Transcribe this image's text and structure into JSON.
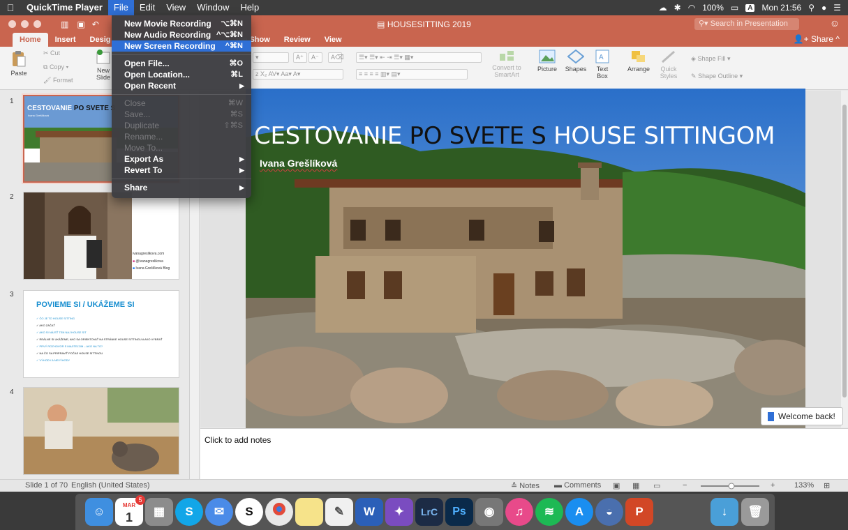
{
  "menubar": {
    "app": "QuickTime Player",
    "items": [
      "File",
      "Edit",
      "View",
      "Window",
      "Help"
    ],
    "battery": "100%",
    "clock": "Mon 21:56"
  },
  "window": {
    "title": "HOUSESITTING 2019",
    "search_placeholder": "Search in Presentation"
  },
  "ribbon": {
    "tabs": [
      "Home",
      "Insert",
      "Desig",
      "ide Show",
      "Review",
      "View"
    ],
    "share": "Share",
    "paste": "Paste",
    "cut": "Cut",
    "copy": "Copy",
    "format": "Format",
    "new_slide": "New\nSlide",
    "convert": "Convert to SmartArt",
    "picture": "Picture",
    "shapes": "Shapes",
    "text_box": "Text Box",
    "arrange": "Arrange",
    "quick_styles": "Quick Styles",
    "shape_fill": "Shape Fill",
    "shape_outline": "Shape Outline"
  },
  "file_menu": {
    "items": [
      {
        "label": "New Movie Recording",
        "shortcut": "⌥⌘N",
        "enabled": true,
        "highlight": false
      },
      {
        "label": "New Audio Recording",
        "shortcut": "^⌥⌘N",
        "enabled": true,
        "highlight": false
      },
      {
        "label": "New Screen Recording",
        "shortcut": "^⌘N",
        "enabled": true,
        "highlight": true
      },
      {
        "label": "Open File...",
        "shortcut": "⌘O",
        "enabled": true
      },
      {
        "label": "Open Location...",
        "shortcut": "⌘L",
        "enabled": true
      },
      {
        "label": "Open Recent",
        "shortcut": "",
        "enabled": true
      },
      {
        "label": "Close",
        "shortcut": "⌘W",
        "enabled": false
      },
      {
        "label": "Save...",
        "shortcut": "⌘S",
        "enabled": false
      },
      {
        "label": "Duplicate",
        "shortcut": "⇧⌘S",
        "enabled": false
      },
      {
        "label": "Rename...",
        "shortcut": "",
        "enabled": false
      },
      {
        "label": "Move To...",
        "shortcut": "",
        "enabled": false
      },
      {
        "label": "Export As",
        "shortcut": "",
        "enabled": true
      },
      {
        "label": "Revert To",
        "shortcut": "",
        "enabled": true
      },
      {
        "label": "Share",
        "shortcut": "",
        "enabled": true
      }
    ]
  },
  "slides": {
    "numbers": [
      "1",
      "2",
      "3",
      "4"
    ],
    "s1_title_a": "CESTOVANIE",
    "s1_title_b": " PO SVETE S",
    "s1_sub": "Ivana Grešlíková",
    "s2_web": "ivanagreslikova.com",
    "s2_ig": "@ivanagreslikova",
    "s2_fb": "Ivana Grešlíková Blog",
    "s3_title": "POVIEME SI / UKÁŽEME SI",
    "s3_items": [
      "ČO JE TO HOUSE SITTING",
      "AKO ZAČAŤ",
      "AKO SI NÁJSŤ TEN NAJ HOUSE SIT",
      "REÁLNE SI UKÁŽEME, AKO SA ORIENTOVAŤ NA STRÁNKE HOUSE SITTINGU A AKO VYBRAŤ",
      "PRVÝ ROZHOVOR S MAJITEĽOM – AKO NA TO?",
      "NA ČO SA PRIPRAVIŤ POČAS HOUSE SITTINGU",
      "VÝHODY A NEVÝHODY"
    ]
  },
  "main_slide": {
    "title_a": "CESTOVANIE ",
    "title_b": "PO SVETE S",
    "title_c": " HOUSE SITTINGOM",
    "author": "Ivana Grešlíková"
  },
  "welcome": "Welcome back!",
  "notes_placeholder": "Click to add notes",
  "statusbar": {
    "slide": "Slide 1 of 70",
    "language": "English (United States)",
    "notes": "Notes",
    "comments": "Comments",
    "zoom": "133%"
  },
  "dock": {
    "calendar_month": "MAR",
    "calendar_day": "1",
    "badge": "5",
    "word": "W",
    "lrc": "LrC",
    "ps": "Ps",
    "ppt": "P"
  }
}
